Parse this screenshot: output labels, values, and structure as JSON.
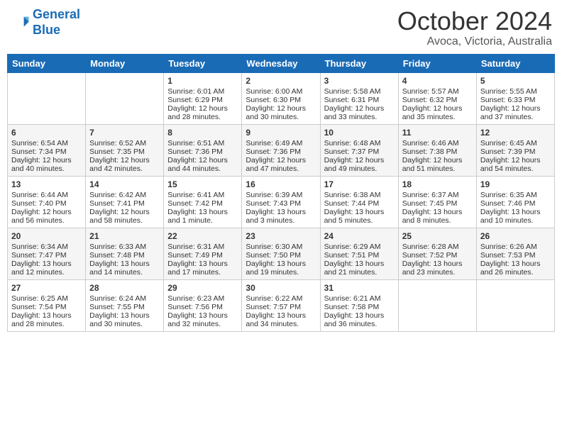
{
  "header": {
    "logo_line1": "General",
    "logo_line2": "Blue",
    "month": "October 2024",
    "location": "Avoca, Victoria, Australia"
  },
  "weekdays": [
    "Sunday",
    "Monday",
    "Tuesday",
    "Wednesday",
    "Thursday",
    "Friday",
    "Saturday"
  ],
  "weeks": [
    [
      {
        "day": "",
        "sunrise": "",
        "sunset": "",
        "daylight": ""
      },
      {
        "day": "",
        "sunrise": "",
        "sunset": "",
        "daylight": ""
      },
      {
        "day": "1",
        "sunrise": "Sunrise: 6:01 AM",
        "sunset": "Sunset: 6:29 PM",
        "daylight": "Daylight: 12 hours and 28 minutes."
      },
      {
        "day": "2",
        "sunrise": "Sunrise: 6:00 AM",
        "sunset": "Sunset: 6:30 PM",
        "daylight": "Daylight: 12 hours and 30 minutes."
      },
      {
        "day": "3",
        "sunrise": "Sunrise: 5:58 AM",
        "sunset": "Sunset: 6:31 PM",
        "daylight": "Daylight: 12 hours and 33 minutes."
      },
      {
        "day": "4",
        "sunrise": "Sunrise: 5:57 AM",
        "sunset": "Sunset: 6:32 PM",
        "daylight": "Daylight: 12 hours and 35 minutes."
      },
      {
        "day": "5",
        "sunrise": "Sunrise: 5:55 AM",
        "sunset": "Sunset: 6:33 PM",
        "daylight": "Daylight: 12 hours and 37 minutes."
      }
    ],
    [
      {
        "day": "6",
        "sunrise": "Sunrise: 6:54 AM",
        "sunset": "Sunset: 7:34 PM",
        "daylight": "Daylight: 12 hours and 40 minutes."
      },
      {
        "day": "7",
        "sunrise": "Sunrise: 6:52 AM",
        "sunset": "Sunset: 7:35 PM",
        "daylight": "Daylight: 12 hours and 42 minutes."
      },
      {
        "day": "8",
        "sunrise": "Sunrise: 6:51 AM",
        "sunset": "Sunset: 7:36 PM",
        "daylight": "Daylight: 12 hours and 44 minutes."
      },
      {
        "day": "9",
        "sunrise": "Sunrise: 6:49 AM",
        "sunset": "Sunset: 7:36 PM",
        "daylight": "Daylight: 12 hours and 47 minutes."
      },
      {
        "day": "10",
        "sunrise": "Sunrise: 6:48 AM",
        "sunset": "Sunset: 7:37 PM",
        "daylight": "Daylight: 12 hours and 49 minutes."
      },
      {
        "day": "11",
        "sunrise": "Sunrise: 6:46 AM",
        "sunset": "Sunset: 7:38 PM",
        "daylight": "Daylight: 12 hours and 51 minutes."
      },
      {
        "day": "12",
        "sunrise": "Sunrise: 6:45 AM",
        "sunset": "Sunset: 7:39 PM",
        "daylight": "Daylight: 12 hours and 54 minutes."
      }
    ],
    [
      {
        "day": "13",
        "sunrise": "Sunrise: 6:44 AM",
        "sunset": "Sunset: 7:40 PM",
        "daylight": "Daylight: 12 hours and 56 minutes."
      },
      {
        "day": "14",
        "sunrise": "Sunrise: 6:42 AM",
        "sunset": "Sunset: 7:41 PM",
        "daylight": "Daylight: 12 hours and 58 minutes."
      },
      {
        "day": "15",
        "sunrise": "Sunrise: 6:41 AM",
        "sunset": "Sunset: 7:42 PM",
        "daylight": "Daylight: 13 hours and 1 minute."
      },
      {
        "day": "16",
        "sunrise": "Sunrise: 6:39 AM",
        "sunset": "Sunset: 7:43 PM",
        "daylight": "Daylight: 13 hours and 3 minutes."
      },
      {
        "day": "17",
        "sunrise": "Sunrise: 6:38 AM",
        "sunset": "Sunset: 7:44 PM",
        "daylight": "Daylight: 13 hours and 5 minutes."
      },
      {
        "day": "18",
        "sunrise": "Sunrise: 6:37 AM",
        "sunset": "Sunset: 7:45 PM",
        "daylight": "Daylight: 13 hours and 8 minutes."
      },
      {
        "day": "19",
        "sunrise": "Sunrise: 6:35 AM",
        "sunset": "Sunset: 7:46 PM",
        "daylight": "Daylight: 13 hours and 10 minutes."
      }
    ],
    [
      {
        "day": "20",
        "sunrise": "Sunrise: 6:34 AM",
        "sunset": "Sunset: 7:47 PM",
        "daylight": "Daylight: 13 hours and 12 minutes."
      },
      {
        "day": "21",
        "sunrise": "Sunrise: 6:33 AM",
        "sunset": "Sunset: 7:48 PM",
        "daylight": "Daylight: 13 hours and 14 minutes."
      },
      {
        "day": "22",
        "sunrise": "Sunrise: 6:31 AM",
        "sunset": "Sunset: 7:49 PM",
        "daylight": "Daylight: 13 hours and 17 minutes."
      },
      {
        "day": "23",
        "sunrise": "Sunrise: 6:30 AM",
        "sunset": "Sunset: 7:50 PM",
        "daylight": "Daylight: 13 hours and 19 minutes."
      },
      {
        "day": "24",
        "sunrise": "Sunrise: 6:29 AM",
        "sunset": "Sunset: 7:51 PM",
        "daylight": "Daylight: 13 hours and 21 minutes."
      },
      {
        "day": "25",
        "sunrise": "Sunrise: 6:28 AM",
        "sunset": "Sunset: 7:52 PM",
        "daylight": "Daylight: 13 hours and 23 minutes."
      },
      {
        "day": "26",
        "sunrise": "Sunrise: 6:26 AM",
        "sunset": "Sunset: 7:53 PM",
        "daylight": "Daylight: 13 hours and 26 minutes."
      }
    ],
    [
      {
        "day": "27",
        "sunrise": "Sunrise: 6:25 AM",
        "sunset": "Sunset: 7:54 PM",
        "daylight": "Daylight: 13 hours and 28 minutes."
      },
      {
        "day": "28",
        "sunrise": "Sunrise: 6:24 AM",
        "sunset": "Sunset: 7:55 PM",
        "daylight": "Daylight: 13 hours and 30 minutes."
      },
      {
        "day": "29",
        "sunrise": "Sunrise: 6:23 AM",
        "sunset": "Sunset: 7:56 PM",
        "daylight": "Daylight: 13 hours and 32 minutes."
      },
      {
        "day": "30",
        "sunrise": "Sunrise: 6:22 AM",
        "sunset": "Sunset: 7:57 PM",
        "daylight": "Daylight: 13 hours and 34 minutes."
      },
      {
        "day": "31",
        "sunrise": "Sunrise: 6:21 AM",
        "sunset": "Sunset: 7:58 PM",
        "daylight": "Daylight: 13 hours and 36 minutes."
      },
      {
        "day": "",
        "sunrise": "",
        "sunset": "",
        "daylight": ""
      },
      {
        "day": "",
        "sunrise": "",
        "sunset": "",
        "daylight": ""
      }
    ]
  ]
}
